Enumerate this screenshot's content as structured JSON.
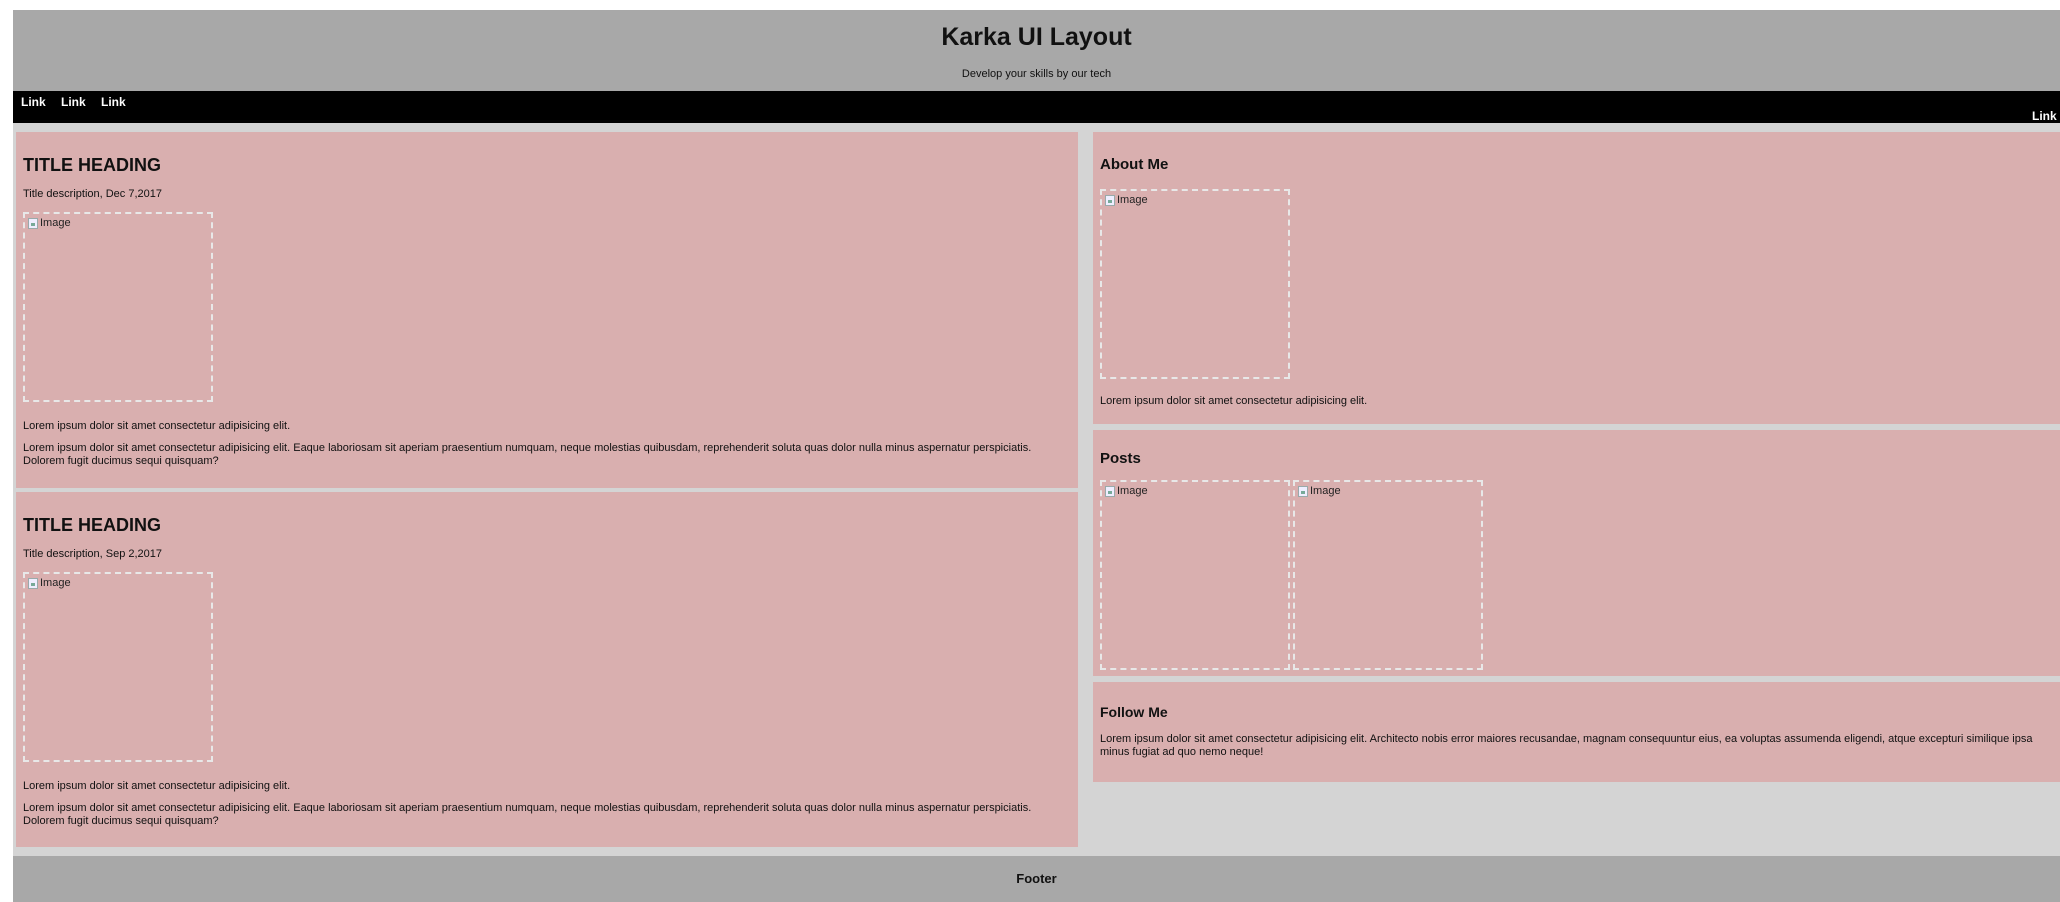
{
  "header": {
    "title": "Karka UI Layout",
    "subtitle": "Develop your skills by our tech"
  },
  "nav": {
    "left_links": [
      "Link",
      "Link",
      "Link"
    ],
    "right_link": "Link"
  },
  "posts": [
    {
      "heading": "TITLE HEADING",
      "description": "Title description, Dec 7,2017",
      "image_alt": "Image",
      "short_text": "Lorem ipsum dolor sit amet consectetur adipisicing elit.",
      "long_text": "Lorem ipsum dolor sit amet consectetur adipisicing elit. Eaque laboriosam sit aperiam praesentium numquam, neque molestias quibusdam, reprehenderit soluta quas dolor nulla minus aspernatur perspiciatis. Dolorem fugit ducimus sequi quisquam?"
    },
    {
      "heading": "TITLE HEADING",
      "description": "Title description, Sep 2,2017",
      "image_alt": "Image",
      "short_text": "Lorem ipsum dolor sit amet consectetur adipisicing elit.",
      "long_text": "Lorem ipsum dolor sit amet consectetur adipisicing elit. Eaque laboriosam sit aperiam praesentium numquam, neque molestias quibusdam, reprehenderit soluta quas dolor nulla minus aspernatur perspiciatis. Dolorem fugit ducimus sequi quisquam?"
    }
  ],
  "sidebar": {
    "about": {
      "heading": "About Me",
      "image_alt": "Image",
      "text": "Lorem ipsum dolor sit amet consectetur adipisicing elit."
    },
    "posts": {
      "heading": "Posts",
      "images": [
        "Image",
        "Image"
      ]
    },
    "follow": {
      "heading": "Follow Me",
      "text": "Lorem ipsum dolor sit amet consectetur adipisicing elit. Architecto nobis error maiores recusandae, magnam consequuntur eius, ea voluptas assumenda eligendi, atque excepturi similique ipsa minus fugiat ad quo nemo neque!"
    }
  },
  "footer": {
    "text": "Footer"
  },
  "colors": {
    "header_bg": "#a8a8a8",
    "nav_bg": "#000000",
    "card_bg": "#d9afaf",
    "page_bg": "#d4d4d4"
  }
}
